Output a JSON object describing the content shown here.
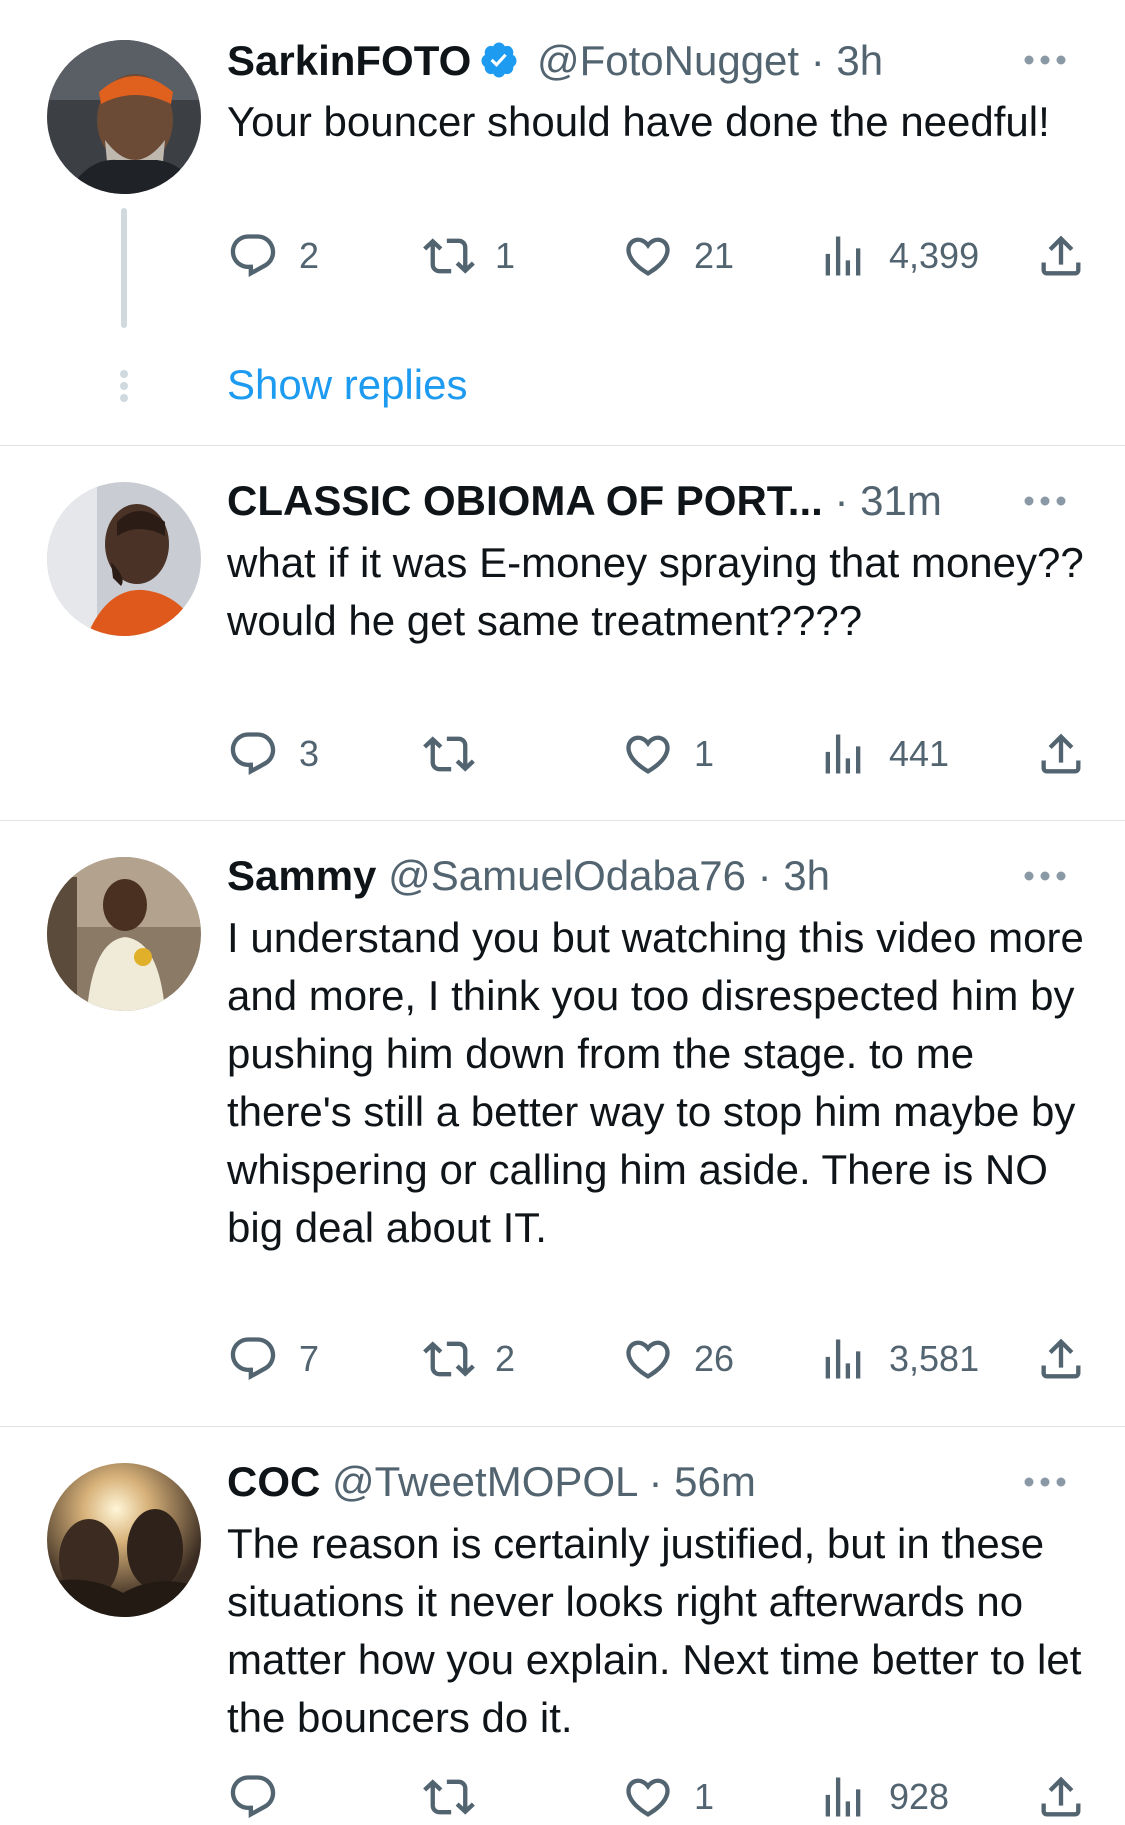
{
  "colors": {
    "accent": "#1d9bf0",
    "secondary_text": "#536471",
    "primary_text": "#0f1419",
    "divider": "#dfe3e6"
  },
  "tweets": [
    {
      "name": "SarkinFOTO",
      "verified": true,
      "handle": "@FotoNugget",
      "dot": "·",
      "time": "3h",
      "text": "Your bouncer should have done the needful!",
      "replies": "2",
      "retweets": "1",
      "likes": "21",
      "views": "4,399"
    },
    {
      "name": "CLASSIC OBIOMA OF PORT...",
      "verified": false,
      "handle": "",
      "dot": "·",
      "time": "31m",
      "text": "what if it was E-money spraying that money?? would he get same treatment????",
      "replies": "3",
      "retweets": "",
      "likes": "1",
      "views": "441"
    },
    {
      "name": "Sammy",
      "verified": false,
      "handle": "@SamuelOdaba76",
      "dot": "·",
      "time": "3h",
      "text": "I understand you but watching this video more and more, I think you too disrespected him by pushing him down from the stage. to me there's still a better way to stop him maybe by whispering or calling him aside. There is NO big deal about IT.",
      "replies": "7",
      "retweets": "2",
      "likes": "26",
      "views": "3,581"
    },
    {
      "name": "COC",
      "verified": false,
      "handle": "@TweetMOPOL",
      "dot": "·",
      "time": "56m",
      "text": "The reason is certainly justified, but in these situations it never looks right afterwards no matter how you explain. Next time better to let the bouncers do it.",
      "replies": "",
      "retweets": "",
      "likes": "1",
      "views": "928"
    }
  ],
  "show_replies_label": "Show replies",
  "icons": [
    "reply-icon",
    "retweet-icon",
    "like-icon",
    "views-icon",
    "share-icon",
    "more-icon",
    "verified-icon"
  ]
}
